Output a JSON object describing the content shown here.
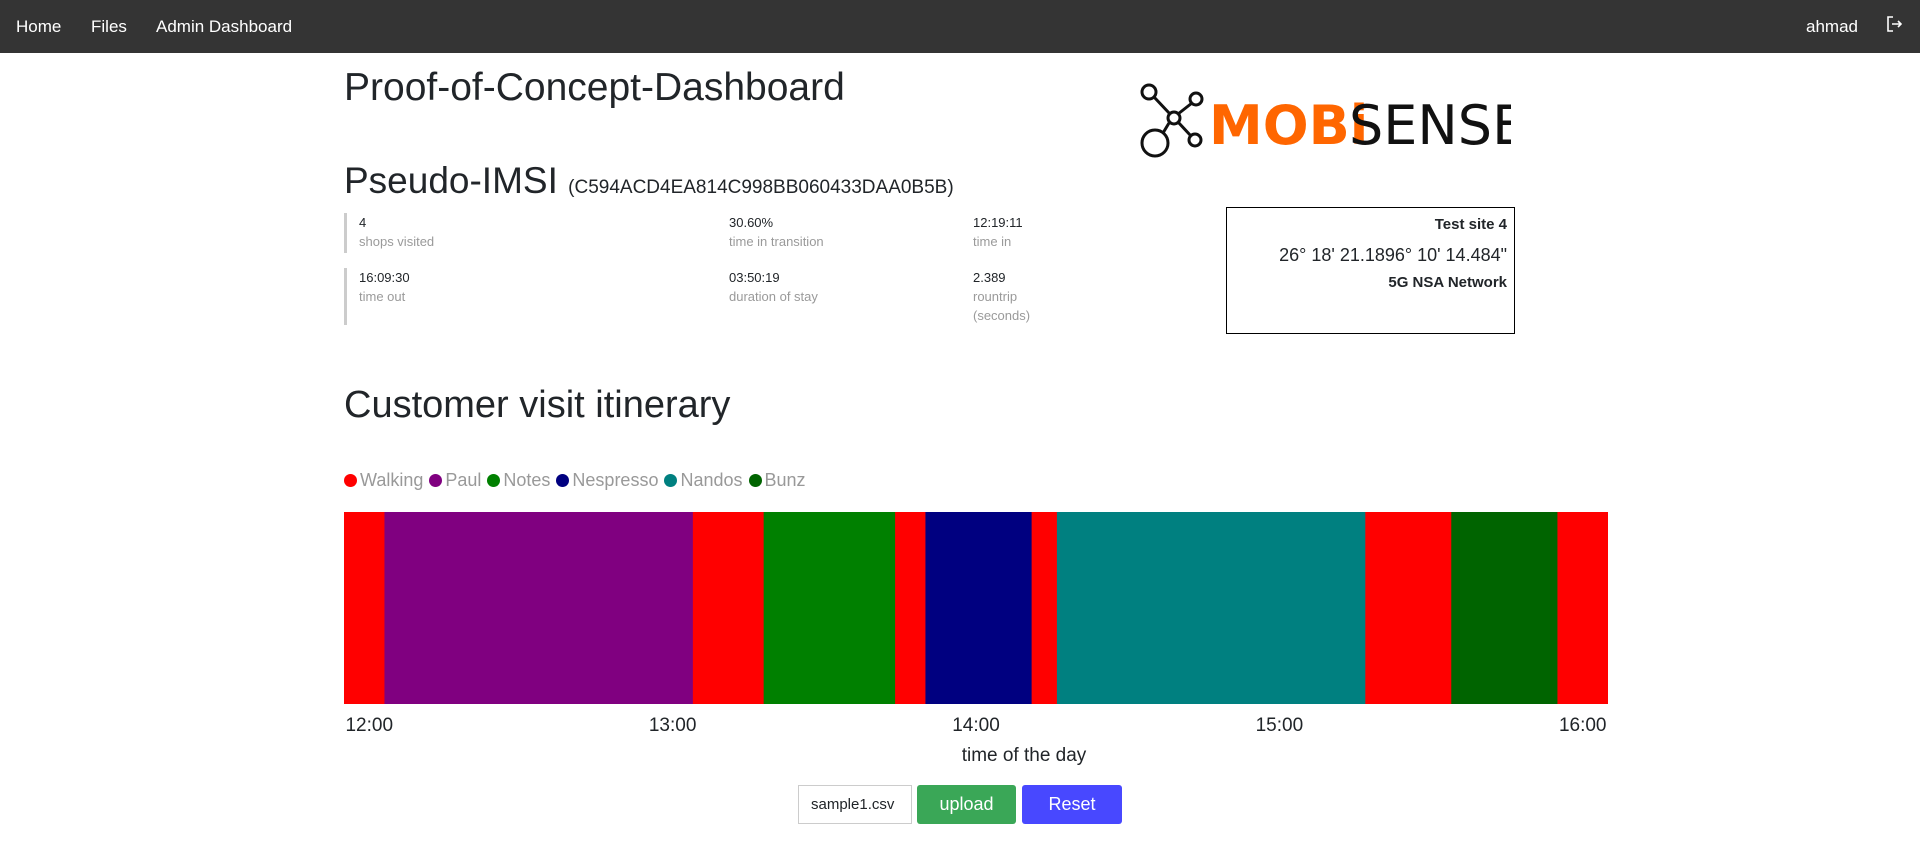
{
  "nav": {
    "items": [
      "Home",
      "Files",
      "Admin Dashboard"
    ],
    "user": "ahmad",
    "logout_icon": "logout-icon"
  },
  "title": "Proof-of-Concept-Dashboard",
  "logo": {
    "text_orange": "MOBi",
    "text_black": "SENSE",
    "color": "#ff6600"
  },
  "imsi": {
    "label": "Pseudo-IMSI",
    "value": "(C594ACD4EA814C998BB060433DAA0B5B)"
  },
  "stats": [
    {
      "value": "4",
      "label": "shops visited"
    },
    {
      "value": "30.60%",
      "label": "time in transition"
    },
    {
      "value": "12:19:11",
      "label": "time in"
    },
    {
      "value": "16:09:30",
      "label": "time out"
    },
    {
      "value": "03:50:19",
      "label": "duration of stay"
    },
    {
      "value": "2.389",
      "label": "rountrip",
      "label2": "(seconds)"
    }
  ],
  "site": {
    "name": "Test site 4",
    "coords": "26° 18' 21.1896° 10' 14.484\"",
    "network": "5G NSA Network"
  },
  "itinerary_title": "Customer visit itinerary",
  "chart_data": {
    "type": "timeline",
    "legend": [
      {
        "name": "Walking",
        "color": "#ff0000"
      },
      {
        "name": "Paul",
        "color": "#800080"
      },
      {
        "name": "Notes",
        "color": "#008000"
      },
      {
        "name": "Nespresso",
        "color": "#000080"
      },
      {
        "name": "Nandos",
        "color": "#008080"
      },
      {
        "name": "Bunz",
        "color": "#006400"
      }
    ],
    "xlim": [
      "11:55",
      "16:05"
    ],
    "ticks": [
      "12:00",
      "13:00",
      "14:00",
      "15:00",
      "16:00"
    ],
    "xlabel": "time of the day",
    "segments": [
      {
        "name": "Walking",
        "start": "11:55",
        "end": "12:03"
      },
      {
        "name": "Paul",
        "start": "12:03",
        "end": "13:04"
      },
      {
        "name": "Walking",
        "start": "13:04",
        "end": "13:18"
      },
      {
        "name": "Notes",
        "start": "13:18",
        "end": "13:44"
      },
      {
        "name": "Walking",
        "start": "13:44",
        "end": "13:50"
      },
      {
        "name": "Nespresso",
        "start": "13:50",
        "end": "14:11"
      },
      {
        "name": "Walking",
        "start": "14:11",
        "end": "14:16"
      },
      {
        "name": "Nandos",
        "start": "14:16",
        "end": "15:17"
      },
      {
        "name": "Walking",
        "start": "15:17",
        "end": "15:34"
      },
      {
        "name": "Bunz",
        "start": "15:34",
        "end": "15:55"
      },
      {
        "name": "Walking",
        "start": "15:55",
        "end": "16:05"
      }
    ]
  },
  "controls": {
    "file": "sample1.csv",
    "upload": "upload",
    "reset": "Reset",
    "upload_color": "#3aa757",
    "reset_color": "#4848ff"
  }
}
